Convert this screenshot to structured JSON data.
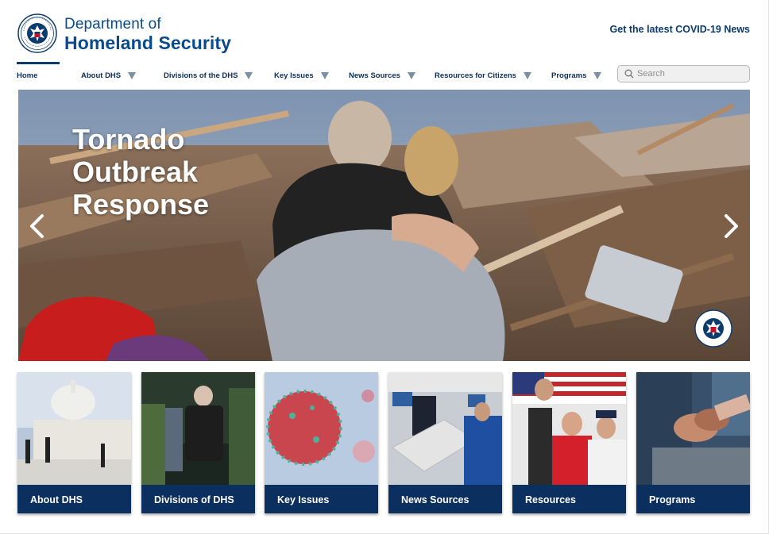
{
  "header": {
    "brand_line1": "Department of",
    "brand_line2": "Homeland Security",
    "covid_link": "Get the latest COVID-19 News",
    "seal_icon": "dhs-seal-icon"
  },
  "nav": {
    "items": [
      {
        "label": "Home",
        "has_caret": false,
        "active": true
      },
      {
        "label": "About DHS",
        "has_caret": true
      },
      {
        "label": "Divisions of the DHS",
        "has_caret": true
      },
      {
        "label": "Key Issues",
        "has_caret": true
      },
      {
        "label": "News Sources",
        "has_caret": true
      },
      {
        "label": "Resources for Citizens",
        "has_caret": true
      },
      {
        "label": "Programs",
        "has_caret": true
      }
    ],
    "search": {
      "placeholder": "Search",
      "icon": "search-icon"
    }
  },
  "hero": {
    "title": "Tornado Outbreak Response",
    "prev_icon": "chevron-left-icon",
    "next_icon": "chevron-right-icon",
    "seal_icon": "dhs-seal-icon"
  },
  "cards": [
    {
      "label": "About DHS",
      "image": "capitol-building-photo"
    },
    {
      "label": "Divisions of DHS",
      "image": "officers-at-night-photo"
    },
    {
      "label": "Key Issues",
      "image": "coronavirus-photo"
    },
    {
      "label": "News Sources",
      "image": "tsa-checkpoint-photo"
    },
    {
      "label": "Resources",
      "image": "pledge-flag-photo"
    },
    {
      "label": "Programs",
      "image": "holding-hands-photo"
    }
  ],
  "colors": {
    "brand_blue": "#0b4a8b",
    "navy": "#0b2f5e",
    "caret_gray": "#7a8ea5"
  }
}
